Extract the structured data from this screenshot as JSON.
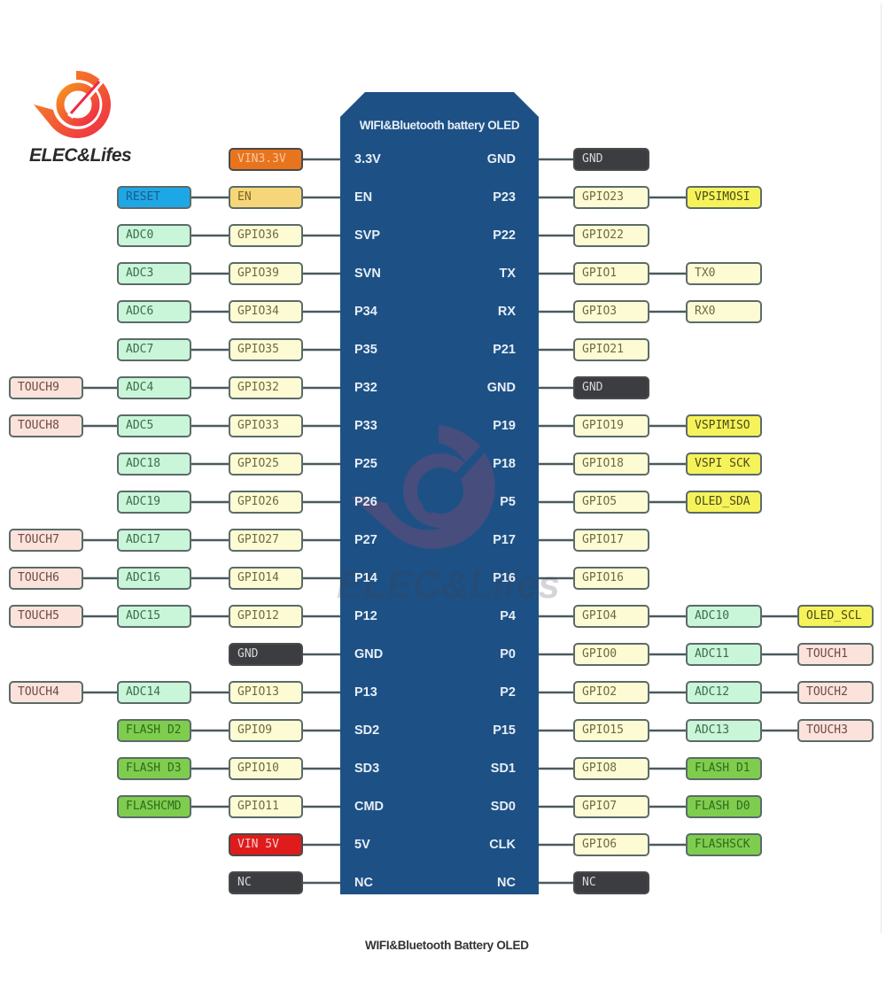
{
  "brand": {
    "name": "ELEC&Lifes",
    "watermark": "ELEC&Lifes"
  },
  "chip": {
    "title": "WIFI&Bluetooth battery OLED"
  },
  "caption": "WIFI&Bluetooth Battery OLED",
  "colors": {
    "chip": "#1d5185",
    "power_3v3": "#e8741e",
    "enable": "#f5d77a",
    "reset": "#1ea7e6",
    "gpio": "#fdfbd4",
    "adc": "#c9f5d9",
    "touch": "#fbe3dc",
    "ground": "#3b3d41",
    "power_5v": "#e01b1b",
    "flash": "#7fcd4f",
    "peripheral_highlight": "#f6f35a",
    "uart": "#fdfbd4"
  },
  "left_pins": [
    {
      "pin": "3.3V",
      "labels": [
        {
          "text": "VIN3.3V",
          "type": "power_3v3"
        }
      ]
    },
    {
      "pin": "EN",
      "labels": [
        {
          "text": "EN",
          "type": "enable"
        },
        {
          "text": "RESET",
          "type": "reset"
        }
      ]
    },
    {
      "pin": "SVP",
      "labels": [
        {
          "text": "GPIO36",
          "type": "gpio"
        },
        {
          "text": "ADC0",
          "type": "adc"
        }
      ]
    },
    {
      "pin": "SVN",
      "labels": [
        {
          "text": "GPIO39",
          "type": "gpio"
        },
        {
          "text": "ADC3",
          "type": "adc"
        }
      ]
    },
    {
      "pin": "P34",
      "labels": [
        {
          "text": "GPIO34",
          "type": "gpio"
        },
        {
          "text": "ADC6",
          "type": "adc"
        }
      ]
    },
    {
      "pin": "P35",
      "labels": [
        {
          "text": "GPIO35",
          "type": "gpio"
        },
        {
          "text": "ADC7",
          "type": "adc"
        }
      ]
    },
    {
      "pin": "P32",
      "labels": [
        {
          "text": "GPIO32",
          "type": "gpio"
        },
        {
          "text": "ADC4",
          "type": "adc"
        },
        {
          "text": "TOUCH9",
          "type": "touch"
        }
      ]
    },
    {
      "pin": "P33",
      "labels": [
        {
          "text": "GPIO33",
          "type": "gpio"
        },
        {
          "text": "ADC5",
          "type": "adc"
        },
        {
          "text": "TOUCH8",
          "type": "touch"
        }
      ]
    },
    {
      "pin": "P25",
      "labels": [
        {
          "text": "GPIO25",
          "type": "gpio"
        },
        {
          "text": "ADC18",
          "type": "adc"
        }
      ]
    },
    {
      "pin": "P26",
      "labels": [
        {
          "text": "GPIO26",
          "type": "gpio"
        },
        {
          "text": "ADC19",
          "type": "adc"
        }
      ]
    },
    {
      "pin": "P27",
      "labels": [
        {
          "text": "GPIO27",
          "type": "gpio"
        },
        {
          "text": "ADC17",
          "type": "adc"
        },
        {
          "text": "TOUCH7",
          "type": "touch"
        }
      ]
    },
    {
      "pin": "P14",
      "labels": [
        {
          "text": "GPIO14",
          "type": "gpio"
        },
        {
          "text": "ADC16",
          "type": "adc"
        },
        {
          "text": "TOUCH6",
          "type": "touch"
        }
      ]
    },
    {
      "pin": "P12",
      "labels": [
        {
          "text": "GPIO12",
          "type": "gpio"
        },
        {
          "text": "ADC15",
          "type": "adc"
        },
        {
          "text": "TOUCH5",
          "type": "touch"
        }
      ]
    },
    {
      "pin": "GND",
      "labels": [
        {
          "text": "GND",
          "type": "ground"
        }
      ]
    },
    {
      "pin": "P13",
      "labels": [
        {
          "text": "GPIO13",
          "type": "gpio"
        },
        {
          "text": "ADC14",
          "type": "adc"
        },
        {
          "text": "TOUCH4",
          "type": "touch"
        }
      ]
    },
    {
      "pin": "SD2",
      "labels": [
        {
          "text": "GPIO9",
          "type": "gpio"
        },
        {
          "text": "FLASH D2",
          "type": "flash"
        }
      ]
    },
    {
      "pin": "SD3",
      "labels": [
        {
          "text": "GPIO10",
          "type": "gpio"
        },
        {
          "text": "FLASH D3",
          "type": "flash"
        }
      ]
    },
    {
      "pin": "CMD",
      "labels": [
        {
          "text": "GPIO11",
          "type": "gpio"
        },
        {
          "text": "FLASHCMD",
          "type": "flash"
        }
      ]
    },
    {
      "pin": "5V",
      "labels": [
        {
          "text": "VIN 5V",
          "type": "power_5v"
        }
      ]
    },
    {
      "pin": "NC",
      "labels": [
        {
          "text": "NC",
          "type": "ground"
        }
      ]
    }
  ],
  "right_pins": [
    {
      "pin": "GND",
      "labels": [
        {
          "text": "GND",
          "type": "ground"
        }
      ]
    },
    {
      "pin": "P23",
      "labels": [
        {
          "text": "GPIO23",
          "type": "gpio"
        },
        {
          "text": "VPSIMOSI",
          "type": "peripheral_highlight"
        }
      ]
    },
    {
      "pin": "P22",
      "labels": [
        {
          "text": "GPIO22",
          "type": "gpio"
        }
      ]
    },
    {
      "pin": "TX",
      "labels": [
        {
          "text": "GPIO1",
          "type": "gpio"
        },
        {
          "text": "TX0",
          "type": "uart"
        }
      ]
    },
    {
      "pin": "RX",
      "labels": [
        {
          "text": "GPIO3",
          "type": "gpio"
        },
        {
          "text": "RX0",
          "type": "uart"
        }
      ]
    },
    {
      "pin": "P21",
      "labels": [
        {
          "text": "GPIO21",
          "type": "gpio"
        }
      ]
    },
    {
      "pin": "GND",
      "labels": [
        {
          "text": "GND",
          "type": "ground"
        }
      ]
    },
    {
      "pin": "P19",
      "labels": [
        {
          "text": "GPIO19",
          "type": "gpio"
        },
        {
          "text": "VSPIMISO",
          "type": "peripheral_highlight"
        }
      ]
    },
    {
      "pin": "P18",
      "labels": [
        {
          "text": "GPIO18",
          "type": "gpio"
        },
        {
          "text": "VSPI SCK",
          "type": "peripheral_highlight"
        }
      ]
    },
    {
      "pin": "P5",
      "labels": [
        {
          "text": "GPIO5",
          "type": "gpio"
        },
        {
          "text": "OLED_SDA",
          "type": "peripheral_highlight"
        }
      ]
    },
    {
      "pin": "P17",
      "labels": [
        {
          "text": "GPIO17",
          "type": "gpio"
        }
      ]
    },
    {
      "pin": "P16",
      "labels": [
        {
          "text": "GPIO16",
          "type": "gpio"
        }
      ]
    },
    {
      "pin": "P4",
      "labels": [
        {
          "text": "GPIO4",
          "type": "gpio"
        },
        {
          "text": "ADC10",
          "type": "adc"
        },
        {
          "text": "OLED_SCL",
          "type": "peripheral_highlight"
        }
      ]
    },
    {
      "pin": "P0",
      "labels": [
        {
          "text": "GPIO0",
          "type": "gpio"
        },
        {
          "text": "ADC11",
          "type": "adc"
        },
        {
          "text": "TOUCH1",
          "type": "touch"
        }
      ]
    },
    {
      "pin": "P2",
      "labels": [
        {
          "text": "GPIO2",
          "type": "gpio"
        },
        {
          "text": "ADC12",
          "type": "adc"
        },
        {
          "text": "TOUCH2",
          "type": "touch"
        }
      ]
    },
    {
      "pin": "P15",
      "labels": [
        {
          "text": "GPIO15",
          "type": "gpio"
        },
        {
          "text": "ADC13",
          "type": "adc"
        },
        {
          "text": "TOUCH3",
          "type": "touch"
        }
      ]
    },
    {
      "pin": "SD1",
      "labels": [
        {
          "text": "GPIO8",
          "type": "gpio"
        },
        {
          "text": "FLASH D1",
          "type": "flash"
        }
      ]
    },
    {
      "pin": "SD0",
      "labels": [
        {
          "text": "GPIO7",
          "type": "gpio"
        },
        {
          "text": "FLASH D0",
          "type": "flash"
        }
      ]
    },
    {
      "pin": "CLK",
      "labels": [
        {
          "text": "GPIO6",
          "type": "gpio"
        },
        {
          "text": "FLASHSCK",
          "type": "flash"
        }
      ]
    },
    {
      "pin": "NC",
      "labels": [
        {
          "text": "NC",
          "type": "ground"
        }
      ]
    }
  ]
}
